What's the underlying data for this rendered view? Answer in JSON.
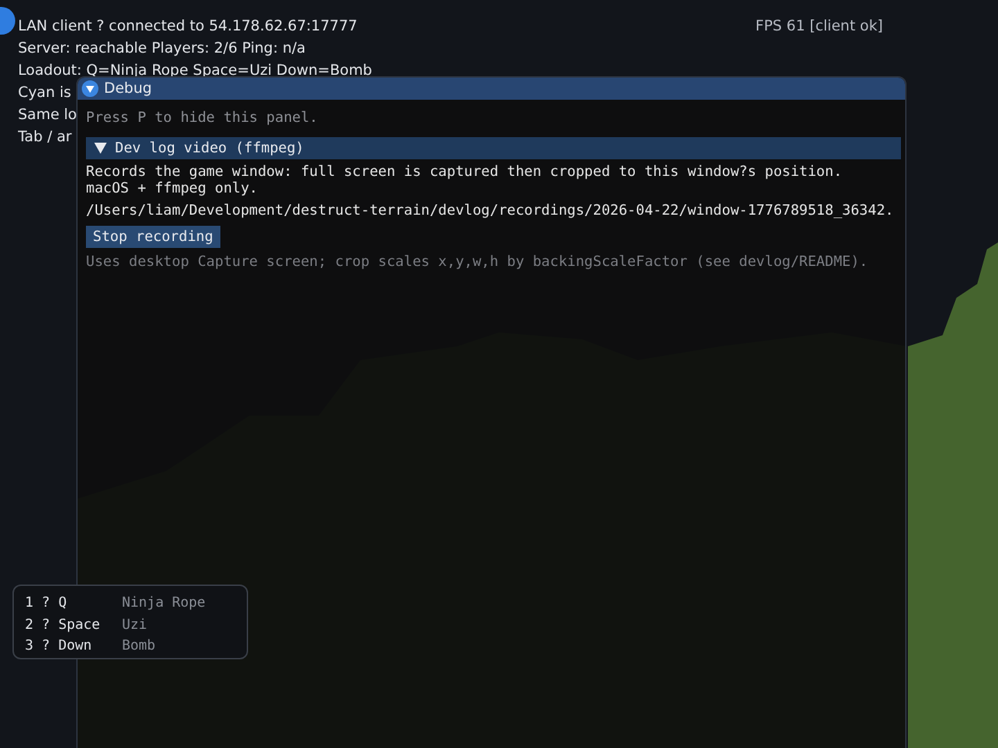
{
  "hud": {
    "lines": [
      "LAN client ? connected to 54.178.62.67:17777",
      "Server: reachable  Players: 2/6  Ping: n/a",
      "Loadout: Q=Ninja Rope  Space=Uzi  Down=Bomb",
      "Cyan is",
      "Same lo",
      "Tab / ar"
    ],
    "fps": "FPS 61  [client ok]"
  },
  "loadout": [
    {
      "key": "1 ? Q",
      "weapon": "Ninja Rope"
    },
    {
      "key": "2 ? Space",
      "weapon": "Uzi"
    },
    {
      "key": "3 ? Down",
      "weapon": "Bomb"
    }
  ],
  "panel": {
    "title": "Debug",
    "hint": "Press P to hide this panel.",
    "section": {
      "label": "Dev log video (ffmpeg)",
      "expanded": true
    },
    "description": "Records the game window: full screen is captured then cropped to this window?s position.\nmacOS + ffmpeg only.",
    "path": "/Users/liam/Development/destruct-terrain/devlog/recordings/2026-04-22/window-1776789518_36342.",
    "button": "Stop recording",
    "note": "Uses desktop Capture screen; crop scales x,y,w,h by backingScaleFactor (see devlog/README)."
  }
}
